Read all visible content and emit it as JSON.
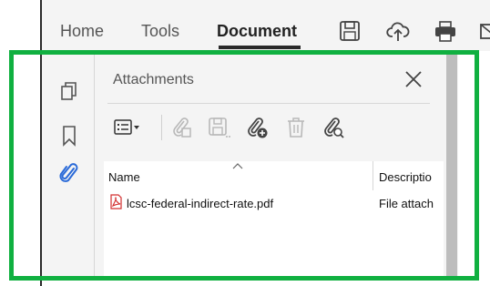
{
  "nav": {
    "tabs": [
      {
        "label": "Home",
        "active": false
      },
      {
        "label": "Tools",
        "active": false
      },
      {
        "label": "Document",
        "active": true
      }
    ],
    "toolbar_icons": [
      "save-icon",
      "upload-cloud-icon",
      "print-icon",
      "mail-icon"
    ]
  },
  "sidebar": {
    "rail_icons": [
      "page-thumbnails-icon",
      "bookmark-icon",
      "paperclip-icon"
    ],
    "active_item": "paperclip-icon"
  },
  "attachments_panel": {
    "title": "Attachments",
    "toolbar": [
      "options-menu-icon",
      "open-attachment-icon",
      "save-attachment-icon",
      "add-attachment-icon",
      "delete-attachment-icon",
      "search-attachment-icon"
    ],
    "table": {
      "columns": [
        "Name",
        "Descriptio"
      ],
      "sorted_column": "Name",
      "rows": [
        {
          "name": "lcsc-federal-indirect-rate.pdf",
          "description": "File attach",
          "file_type_icon": "pdf-file-icon"
        }
      ]
    }
  },
  "colors": {
    "highlight_border": "#10b040",
    "accent_blue": "#2a6ad8",
    "pdf_red": "#d32f2f"
  }
}
